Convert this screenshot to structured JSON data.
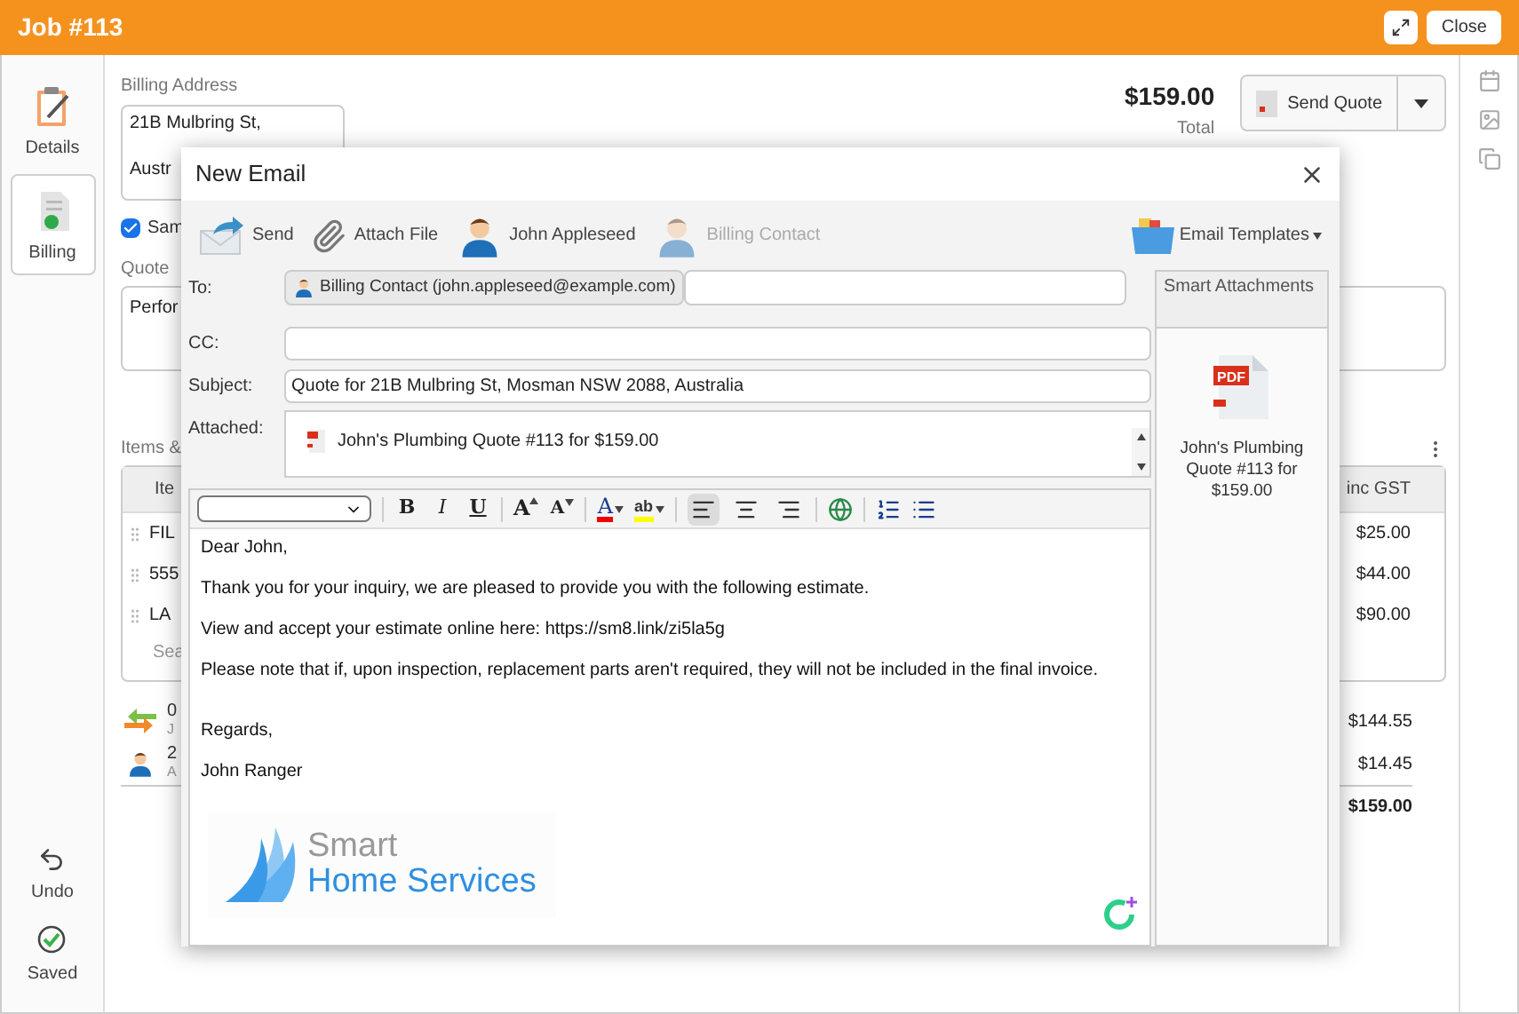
{
  "window": {
    "title": "Job #113",
    "close": "Close"
  },
  "left_sidebar": {
    "items": [
      {
        "label": "Details",
        "kind": "details",
        "selected": false
      },
      {
        "label": "Billing",
        "kind": "billing",
        "selected": true
      }
    ],
    "actions": [
      {
        "label": "Undo",
        "kind": "undo"
      },
      {
        "label": "Saved",
        "kind": "saved"
      }
    ]
  },
  "billing": {
    "label": "Billing Address",
    "address_lines": [
      "21B Mulbring St,",
      "Austr"
    ],
    "same_checkbox": {
      "label": "Sam",
      "checked": true
    },
    "quote_label": "Quote",
    "quote_text": "Perfor"
  },
  "summary": {
    "amount": "$159.00",
    "caption": "Total",
    "send_button": "Send Quote"
  },
  "items": {
    "label": "Items &",
    "columns": [
      "Ite",
      "inc GST"
    ],
    "rows": [
      {
        "item": "FIL",
        "total": "$25.00"
      },
      {
        "item": "555",
        "total": "$44.00"
      },
      {
        "item": "LA",
        "total": "$90.00"
      }
    ],
    "search_placeholder": "Sea"
  },
  "totals": [
    {
      "kind": "transfer",
      "line_1": "0",
      "line_2": "J",
      "value": "$144.55",
      "bold": false
    },
    {
      "kind": "person",
      "line_1": "2",
      "line_2": "A",
      "value": "$14.45",
      "bold": false
    },
    {
      "kind": "none",
      "value": "$159.00",
      "bold": true
    }
  ],
  "email_dialog": {
    "title": "New Email",
    "toolbar": [
      {
        "label": "Send",
        "kind": "send",
        "disabled": false
      },
      {
        "label": "Attach File",
        "kind": "attach",
        "disabled": false
      },
      {
        "label": "John Appleseed",
        "kind": "contact",
        "disabled": false
      },
      {
        "label": "Billing Contact",
        "kind": "contact",
        "disabled": true
      }
    ],
    "templates_button": "Email Templates",
    "to": {
      "label": "To:",
      "recipients": [
        "Billing Contact (john.appleseed@example.com)"
      ]
    },
    "cc": {
      "label": "CC:"
    },
    "subject": {
      "label": "Subject:",
      "value": "Quote for 21B Mulbring St, Mosman NSW 2088, Australia"
    },
    "attached": {
      "label": "Attached:",
      "files": [
        "John's Plumbing Quote #113 for $159.00"
      ]
    },
    "editor_toolbar": [
      {
        "kind": "bold",
        "label": "B"
      },
      {
        "kind": "italic",
        "label": "I"
      },
      {
        "kind": "underline",
        "label": "U"
      },
      {
        "kind": "grow",
        "label": "A"
      },
      {
        "kind": "shrink",
        "label": "A"
      },
      {
        "kind": "color",
        "label": "A"
      },
      {
        "kind": "highlight",
        "label": "ab"
      },
      {
        "kind": "align-left",
        "selected": true
      },
      {
        "kind": "align-center",
        "selected": false
      },
      {
        "kind": "align-right",
        "selected": false
      },
      {
        "kind": "link"
      },
      {
        "kind": "ordered-list"
      },
      {
        "kind": "bullet-list"
      }
    ],
    "body": [
      "Dear John,",
      "Thank you for your inquiry, we are pleased to provide you with the following estimate.",
      "View and accept your estimate online here: https://sm8.link/zi5la5g",
      "Please note that if, upon inspection, replacement parts aren't required, they will not be included in the final invoice."
    ],
    "closing": [
      "Regards,",
      "John Ranger"
    ],
    "signature": {
      "line_1": "Smart",
      "line_2": "Home Services"
    },
    "smart_attachments": {
      "title": "Smart Attachments",
      "files": [
        {
          "name": "John's Plumbing Quote #113 for $159.00",
          "type": "PDF"
        }
      ]
    }
  }
}
